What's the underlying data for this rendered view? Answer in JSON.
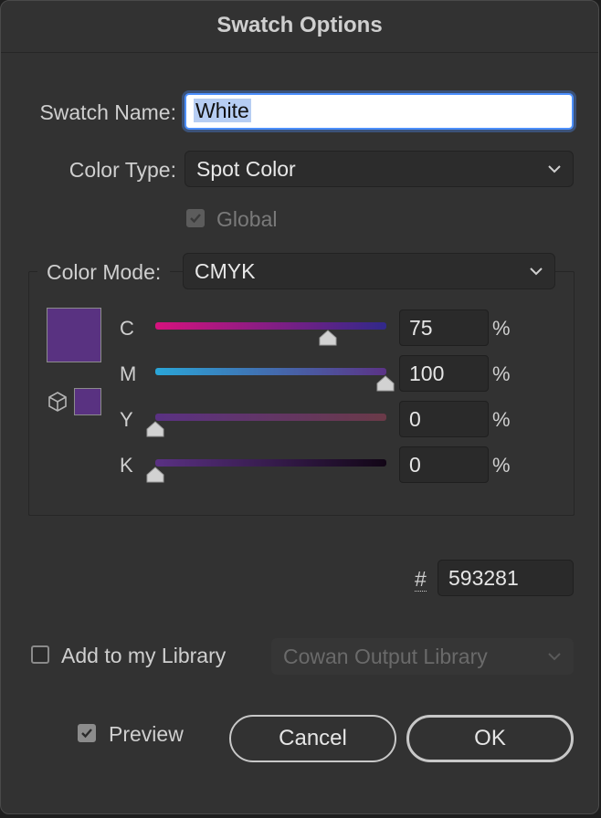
{
  "dialog": {
    "title": "Swatch Options"
  },
  "swatch_name": {
    "label": "Swatch Name:",
    "value": "White"
  },
  "color_type": {
    "label": "Color Type:",
    "selected": "Spot Color"
  },
  "global": {
    "label": "Global",
    "checked": true,
    "enabled": false
  },
  "color_mode": {
    "label": "Color Mode:",
    "selected": "CMYK"
  },
  "swatch_color": "#593281",
  "channels": [
    {
      "letter": "C",
      "value": "75",
      "unit": "%"
    },
    {
      "letter": "M",
      "value": "100",
      "unit": "%"
    },
    {
      "letter": "Y",
      "value": "0",
      "unit": "%"
    },
    {
      "letter": "K",
      "value": "0",
      "unit": "%"
    }
  ],
  "hex": {
    "label": "#",
    "value": "593281"
  },
  "library": {
    "label": "Add to my Library",
    "checked": false,
    "selected": "Cowan Output Library"
  },
  "preview": {
    "label": "Preview",
    "checked": true
  },
  "buttons": {
    "cancel": "Cancel",
    "ok": "OK"
  }
}
